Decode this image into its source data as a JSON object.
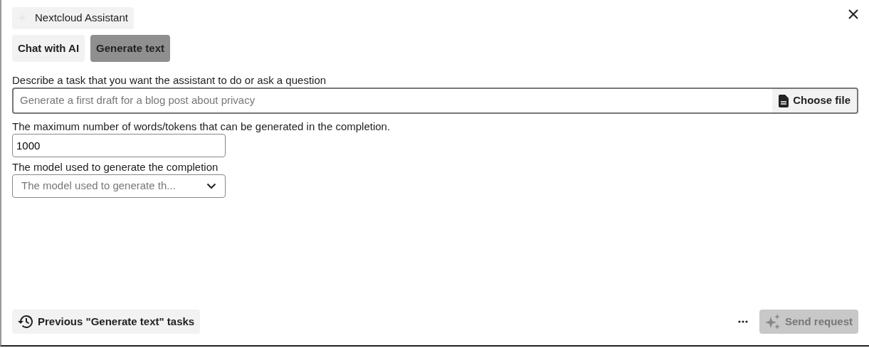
{
  "dialog": {
    "title": "Nextcloud Assistant"
  },
  "tabs": [
    {
      "label": "Chat with AI",
      "selected": false
    },
    {
      "label": "Generate text",
      "selected": true
    }
  ],
  "fields": [
    {
      "kind": "prompt",
      "label": "Describe a task that you want the assistant to do or ask a question",
      "placeholder": "Generate a first draft for a blog post about privacy",
      "button": "Choose file"
    },
    {
      "kind": "number",
      "label": "The maximum number of words/tokens that can be generated in the completion.",
      "value": "1000"
    },
    {
      "kind": "select",
      "label": "The model used to generate the completion",
      "placeholder": "The model used to generate th..."
    }
  ],
  "footer": {
    "history_button": "Previous \"Generate text\" tasks",
    "send_button": {
      "label": "Send request",
      "disabled": true
    }
  }
}
